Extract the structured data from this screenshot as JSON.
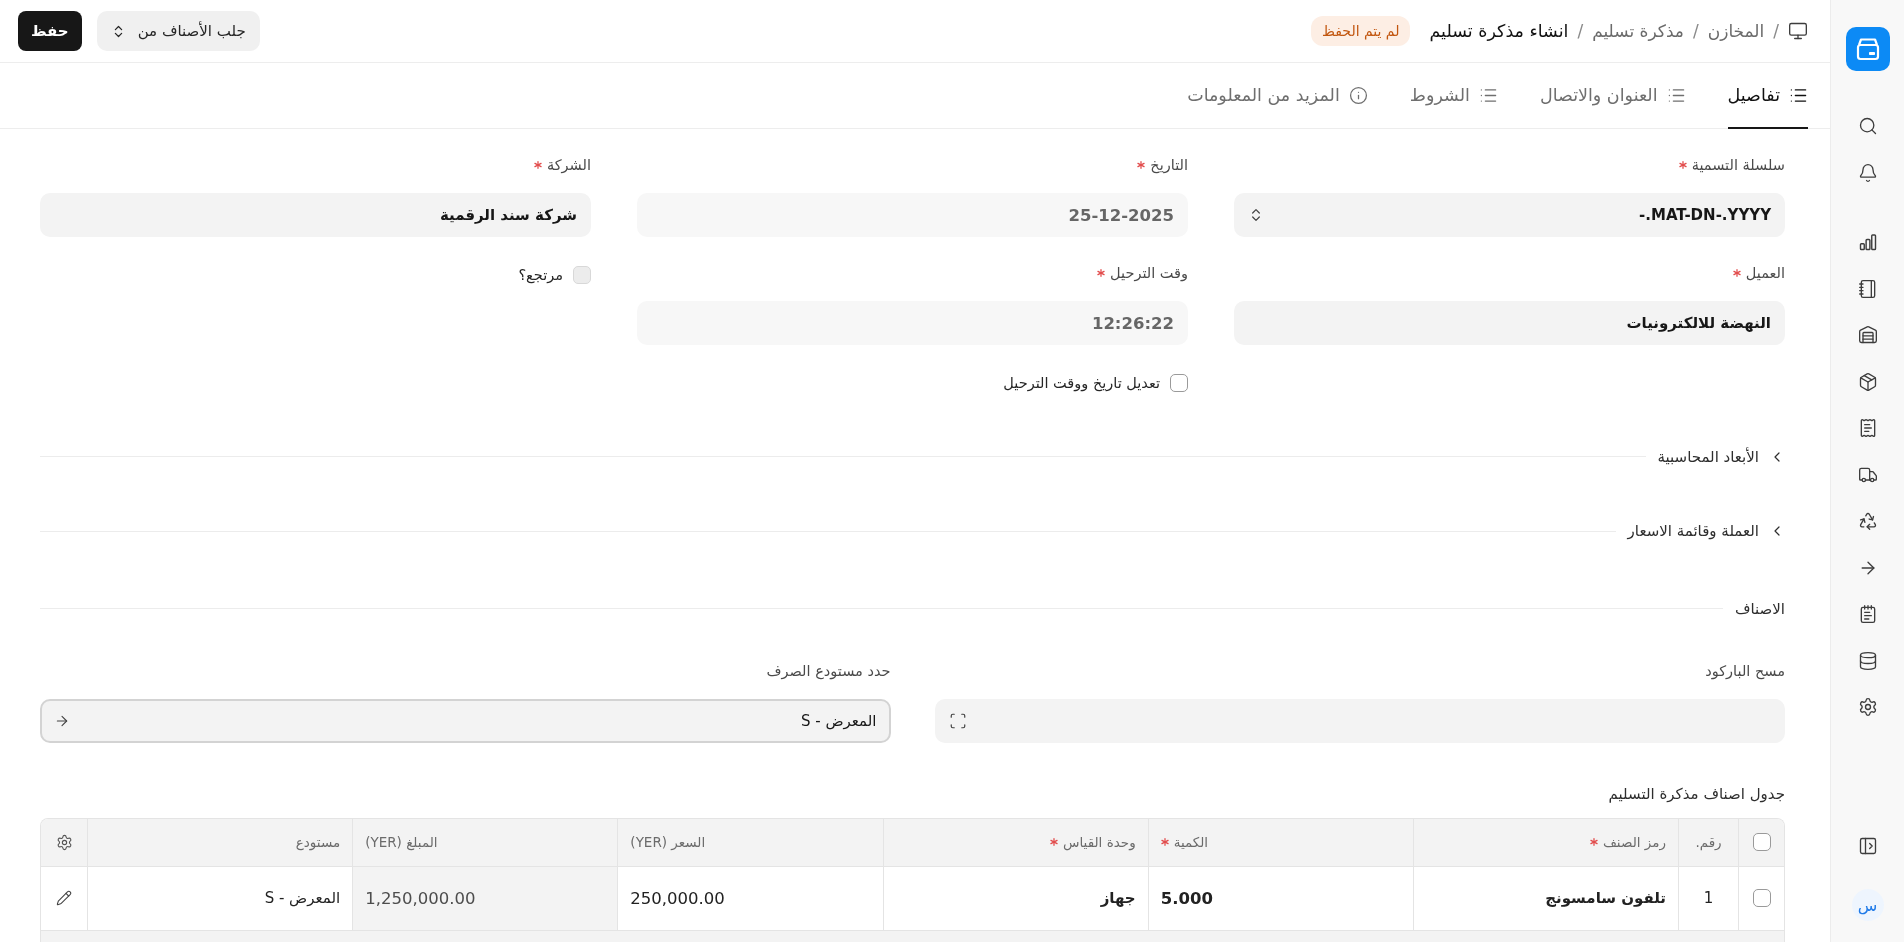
{
  "header": {
    "breadcrumbs": [
      {
        "separator": "/",
        "label": "المخازن",
        "kind": "link"
      },
      {
        "separator": "/",
        "label": "مذكرة تسليم",
        "kind": "link"
      },
      {
        "separator": "/",
        "label": "انشاء مذكرة تسليم",
        "kind": "title"
      }
    ],
    "status_badge": "لم يتم الحفظ",
    "buttons": [
      {
        "label": "جلب الأصناف من",
        "kind": "dropdown"
      },
      {
        "label": "حفظ",
        "kind": "primary"
      }
    ]
  },
  "tabs": [
    {
      "label": "تفاصيل",
      "kind": "section",
      "selected": true
    },
    {
      "label": "العنوان والاتصال",
      "kind": "section",
      "selected": false
    },
    {
      "label": "الشروط",
      "kind": "section",
      "selected": false
    },
    {
      "label": "المزيد من المعلومات",
      "kind": "info",
      "selected": false
    }
  ],
  "details": {
    "columns": [
      [
        {
          "kind": "select",
          "label": "سلسلة التسمية",
          "required": true,
          "value": "MAT-DN-.YYYY.-",
          "disabled": false
        },
        {
          "kind": "link",
          "label": "العميل",
          "required": true,
          "value": "النهضة للالكترونيات",
          "disabled": false
        }
      ],
      [
        {
          "kind": "date",
          "label": "التاريخ",
          "required": true,
          "value": "25-12-2025",
          "disabled": true
        },
        {
          "kind": "time",
          "label": "وقت الترحيل",
          "required": true,
          "value": "12:26:22",
          "disabled": true
        },
        {
          "kind": "checkbox",
          "label": "تعديل تاريخ ووقت الترحيل",
          "checked": false,
          "disabled": false
        }
      ],
      [
        {
          "kind": "link",
          "label": "الشركة",
          "required": true,
          "value": "شركة سند الرقمية",
          "disabled": false
        },
        {
          "kind": "checkbox",
          "label": "مرتجع؟",
          "checked": false,
          "disabled": true
        }
      ]
    ]
  },
  "sections": [
    {
      "title": "الأبعاد المحاسبية",
      "expanded": false
    },
    {
      "title": "العملة وقائمة الاسعار",
      "expanded": false
    }
  ],
  "items_section": {
    "title": "الاصناف",
    "fields": [
      {
        "kind": "barcode",
        "label": "مسح الباركود",
        "focused": false
      },
      {
        "kind": "link",
        "label": "حدد مستودع الصرف",
        "value": "المعرض - S",
        "focused": true
      }
    ]
  },
  "table": {
    "title": "جدول اصناف مذكرة التسليم",
    "checked": false,
    "columns": [
      {
        "label": "رقم.",
        "required": false,
        "kind": "index",
        "read_only": false
      },
      {
        "label": "رمز الصنف",
        "required": true,
        "kind": "item",
        "read_only": false
      },
      {
        "label": "الكمية",
        "required": true,
        "kind": "float",
        "read_only": false
      },
      {
        "label": "وحدة القياس",
        "required": true,
        "kind": "uom",
        "read_only": false
      },
      {
        "label": "السعر (YER)",
        "required": false,
        "kind": "currency",
        "read_only": false
      },
      {
        "label": "المبلغ (YER)",
        "required": false,
        "kind": "currency",
        "read_only": true
      },
      {
        "label": "مستودع",
        "required": false,
        "kind": "warehouse",
        "read_only": false
      }
    ],
    "rows": [
      {
        "selected": false,
        "cells": [
          "1",
          "تلفون سامسونج",
          "5.000",
          "جهاز",
          "250,000.00",
          "1,250,000.00",
          "المعرض - S"
        ]
      }
    ]
  },
  "sidebar": {
    "user_initial": "س"
  }
}
